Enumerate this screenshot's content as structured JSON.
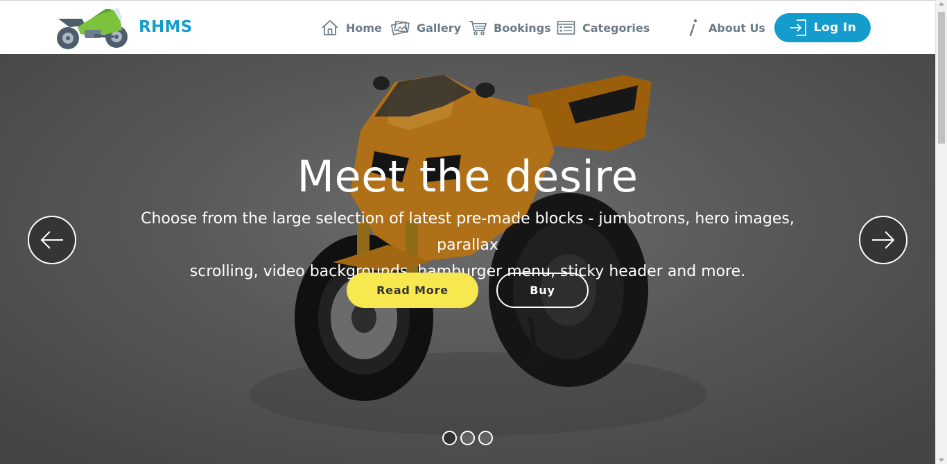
{
  "brand": {
    "name": "RHMS",
    "logo_icon": "motorcycle-icon"
  },
  "nav": {
    "items": [
      {
        "label": "Home",
        "icon": "home-icon"
      },
      {
        "label": "Gallery",
        "icon": "gallery-icon"
      },
      {
        "label": "Bookings",
        "icon": "cart-icon"
      },
      {
        "label": "Categories",
        "icon": "list-icon"
      },
      {
        "label": "About Us",
        "icon": "info-icon"
      }
    ],
    "login": {
      "label": "Log In",
      "icon": "login-icon"
    }
  },
  "hero": {
    "title": "Meet the desire",
    "subtitle_line1": "Choose from the large selection of latest pre-made blocks - jumbotrons, hero images, parallax",
    "subtitle_line2": "scrolling, video backgrounds, hamburger menu, sticky header and more.",
    "read_more_label": "Read More",
    "buy_label": "Buy",
    "slides_count": 3,
    "active_slide": 1
  },
  "colors": {
    "brand": "#149dcc",
    "nav_text": "#6b7a86",
    "read_more_bg": "#f6e84e",
    "bike_orange": "#e0901e"
  }
}
